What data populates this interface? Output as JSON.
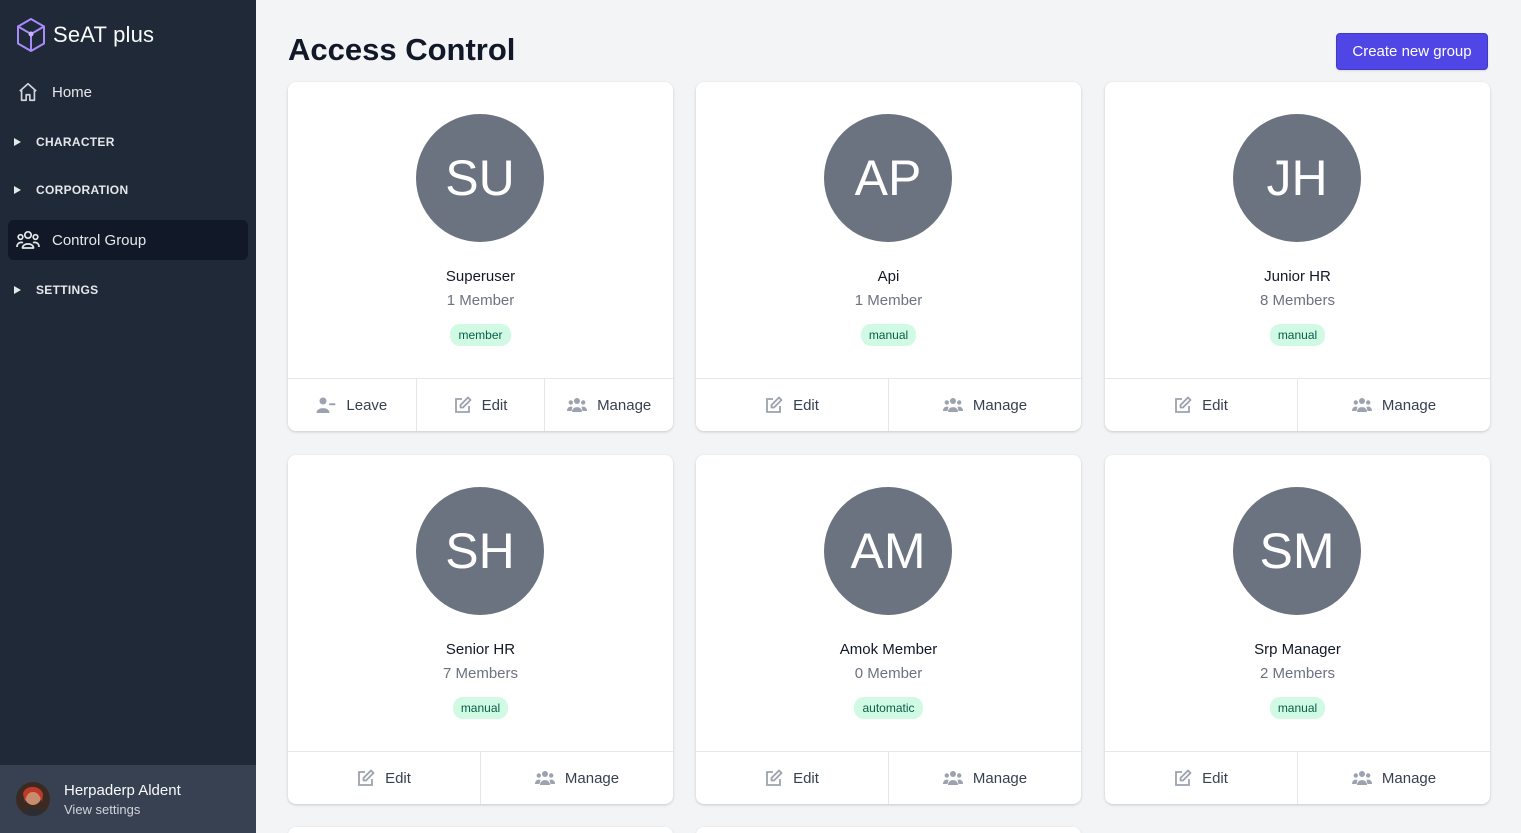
{
  "brand": {
    "name": "SeAT plus"
  },
  "sidebar": {
    "home": "Home",
    "sections": [
      "CHARACTER",
      "CORPORATION"
    ],
    "active_item": "Control Group",
    "settings": "SETTINGS"
  },
  "user": {
    "name": "Herpaderp Aldent",
    "sub": "View settings"
  },
  "header": {
    "title": "Access Control",
    "create_label": "Create new group"
  },
  "actions": {
    "leave": "Leave",
    "edit": "Edit",
    "manage": "Manage"
  },
  "groups": [
    {
      "initials": "SU",
      "name": "Superuser",
      "members": "1 Member",
      "badge": "member"
    },
    {
      "initials": "AP",
      "name": "Api",
      "members": "1 Member",
      "badge": "manual"
    },
    {
      "initials": "JH",
      "name": "Junior HR",
      "members": "8 Members",
      "badge": "manual"
    },
    {
      "initials": "SH",
      "name": "Senior HR",
      "members": "7 Members",
      "badge": "manual"
    },
    {
      "initials": "AM",
      "name": "Amok Member",
      "members": "0 Member",
      "badge": "automatic"
    },
    {
      "initials": "SM",
      "name": "Srp Manager",
      "members": "2 Members",
      "badge": "manual"
    }
  ],
  "colors": {
    "sidebar": "#1f2937",
    "accent": "#4f46e5",
    "avatar": "#6b7280",
    "badge_bg": "#d1fae5"
  }
}
